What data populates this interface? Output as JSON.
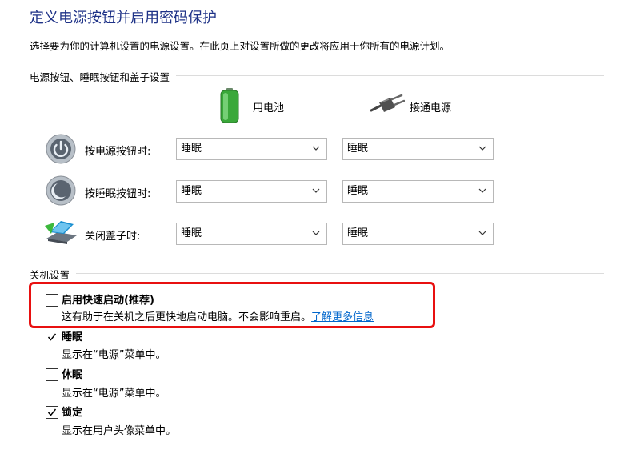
{
  "page": {
    "title": "定义电源按钮并启用密码保护",
    "description": "选择要为你的计算机设置的电源设置。在此页上对设置所做的更改将应用于你所有的电源计划。"
  },
  "buttons_section": {
    "heading": "电源按钮、睡眠按钮和盖子设置",
    "battery_label": "用电池",
    "plugged_label": "接通电源",
    "rows": [
      {
        "label": "按电源按钮时:",
        "battery_value": "睡眠",
        "plugged_value": "睡眠",
        "icon": "power-button-icon"
      },
      {
        "label": "按睡眠按钮时:",
        "battery_value": "睡眠",
        "plugged_value": "睡眠",
        "icon": "sleep-button-icon"
      },
      {
        "label": "关闭盖子时:",
        "battery_value": "睡眠",
        "plugged_value": "睡眠",
        "icon": "laptop-lid-icon"
      }
    ]
  },
  "shutdown_section": {
    "heading": "关机设置",
    "options": [
      {
        "label": "启用快速启动(推荐)",
        "checked": false,
        "description": "这有助于在关机之后更快地启动电脑。不会影响重启。",
        "link": "了解更多信息"
      },
      {
        "label": "睡眠",
        "checked": true,
        "description": "显示在“电源”菜单中。"
      },
      {
        "label": "休眠",
        "checked": false,
        "description": "显示在“电源”菜单中。"
      },
      {
        "label": "锁定",
        "checked": true,
        "description": "显示在用户头像菜单中。"
      }
    ]
  },
  "colors": {
    "title": "#1e3287",
    "highlight_border": "#e81010",
    "link": "#0066cc"
  }
}
